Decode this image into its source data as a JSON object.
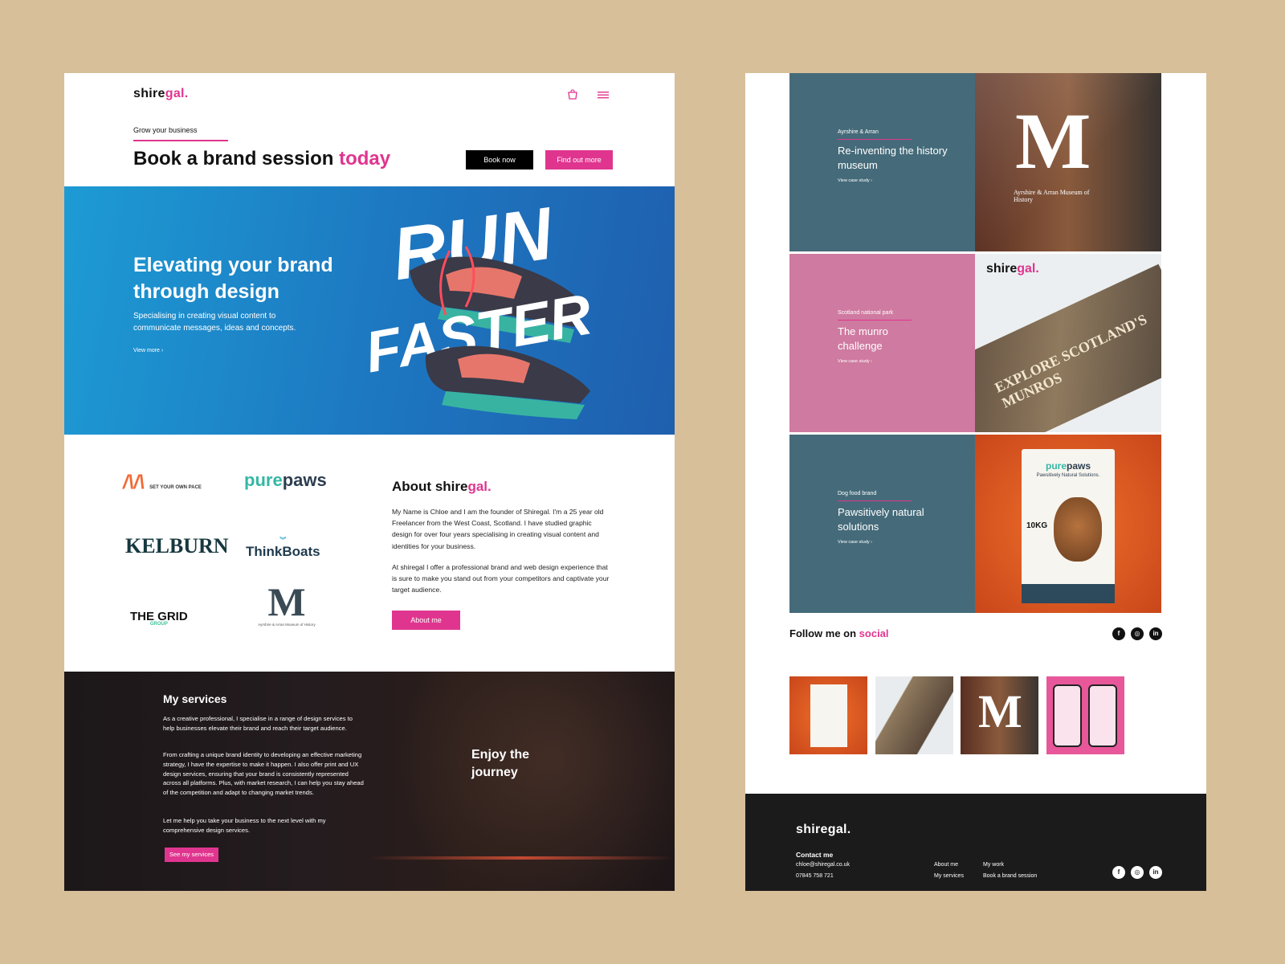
{
  "colors": {
    "accent": "#e0358f",
    "background": "#d7bf99",
    "hero_blue": "#1d76c0",
    "slate": "#456b7a",
    "rose": "#cf7aa0",
    "orange": "#e85c22"
  },
  "brand": {
    "logo_main": "shire",
    "logo_accent": "gal."
  },
  "header": {
    "icons": [
      "bag-icon",
      "menu-icon"
    ],
    "eyebrow": "Grow your business",
    "heading_main": "Book a brand session ",
    "heading_accent": "today",
    "book_now": "Book now",
    "find_out_more": "Find out more"
  },
  "hero": {
    "title": "Elevating your brand through design",
    "subtitle": "Specialising in creating visual content to communicate messages, ideas and concepts.",
    "link": "View more  ›",
    "art_word1": "RUN",
    "art_word2": "FASTER"
  },
  "clients": {
    "sop_mark": "/\\/\\",
    "sop_text": "SET YOUR OWN PACE",
    "purepaws_a": "pure",
    "purepaws_b": "paws",
    "kelburn": "KELBURN",
    "thinkboats": "ThinkBoats",
    "thegrid": "THE GRID",
    "thegrid_sub": "GROUP",
    "museum_mark": "M",
    "museum_text": "Ayrshire & Arran Museum of History"
  },
  "about": {
    "title_main": "About ",
    "title_logo_a": "shire",
    "title_logo_b": "gal.",
    "p1": "My Name is Chloe and I am the founder of Shiregal. I'm a 25 year old Freelancer from the West Coast, Scotland. I have studied graphic design for over four years specialising in creating visual content and identities for your business.",
    "p2": "At shiregal I offer a professional brand and web design experience that is sure to make you stand out from your competitors and captivate your target audience.",
    "button": "About me"
  },
  "services": {
    "title": "My services",
    "p1": "As a creative professional, I specialise in a range of design services to help businesses elevate their brand and reach their target audience.",
    "p2": "From crafting a unique brand identity to developing an effective marketing strategy, I have the expertise to make it happen. I also offer print and UX design services, ensuring that your brand is consistently represented across all platforms. Plus, with market research, I can help you stay ahead of the competition and adapt to changing market trends.",
    "p3": "Let me help you take your business to the next level with my comprehensive design services.",
    "button": "See my services",
    "tagline": "Enjoy the journey"
  },
  "cases": [
    {
      "tag": "Ayrshire & Arran",
      "title": "Re-inventing the history museum",
      "link": "View case study  ›",
      "image_text": "Ayrshire & Arran Museum of History"
    },
    {
      "tag": "Scotland national park",
      "title": "The munro challenge",
      "link": "View case study  ›",
      "image_text": "EXPLORE SCOTLAND'S MUNROS"
    },
    {
      "tag": "Dog food brand",
      "title": "Pawsitively natural solutions",
      "link": "View case study  ›",
      "image_text": "Pawsitively Natural Solutions.",
      "image_weight": "10KG"
    }
  ],
  "follow": {
    "title_main": "Follow me on ",
    "title_accent": "social",
    "icons": [
      "facebook-icon",
      "instagram-icon",
      "linkedin-icon"
    ]
  },
  "footer": {
    "logo": "shiregal.",
    "contact_title": "Contact me",
    "email": "chloe@shiregal.co.uk",
    "phone": "07845 758 721",
    "links": [
      "About me",
      "My services",
      "My work",
      "Book a brand session"
    ]
  }
}
